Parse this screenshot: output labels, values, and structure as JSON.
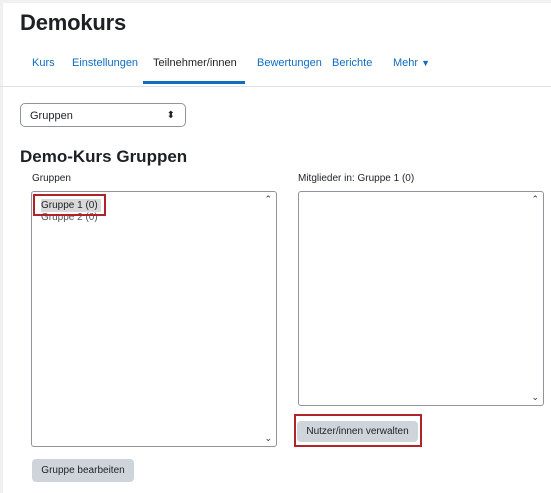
{
  "course": {
    "title": "Demokurs"
  },
  "nav": {
    "tabs": [
      {
        "label": "Kurs"
      },
      {
        "label": "Einstellungen"
      },
      {
        "label": "Teilnehmer/innen",
        "active": true
      },
      {
        "label": "Bewertungen"
      },
      {
        "label": "Berichte"
      },
      {
        "label": "Mehr"
      }
    ]
  },
  "view_select": {
    "value": "Gruppen"
  },
  "page": {
    "heading": "Demo-Kurs Gruppen"
  },
  "groups_panel": {
    "label": "Gruppen",
    "items": [
      {
        "label": "Gruppe 1 (0)",
        "selected": true
      },
      {
        "label": "Gruppe 2 (0)",
        "selected": false
      }
    ],
    "edit_button": "Gruppe bearbeiten"
  },
  "members_panel": {
    "label": "Mitglieder in: Gruppe 1 (0)",
    "manage_button": "Nutzer/innen verwalten"
  },
  "colors": {
    "accent": "#0f6cbf",
    "highlight": "#b0232a",
    "button": "#ced4da"
  }
}
